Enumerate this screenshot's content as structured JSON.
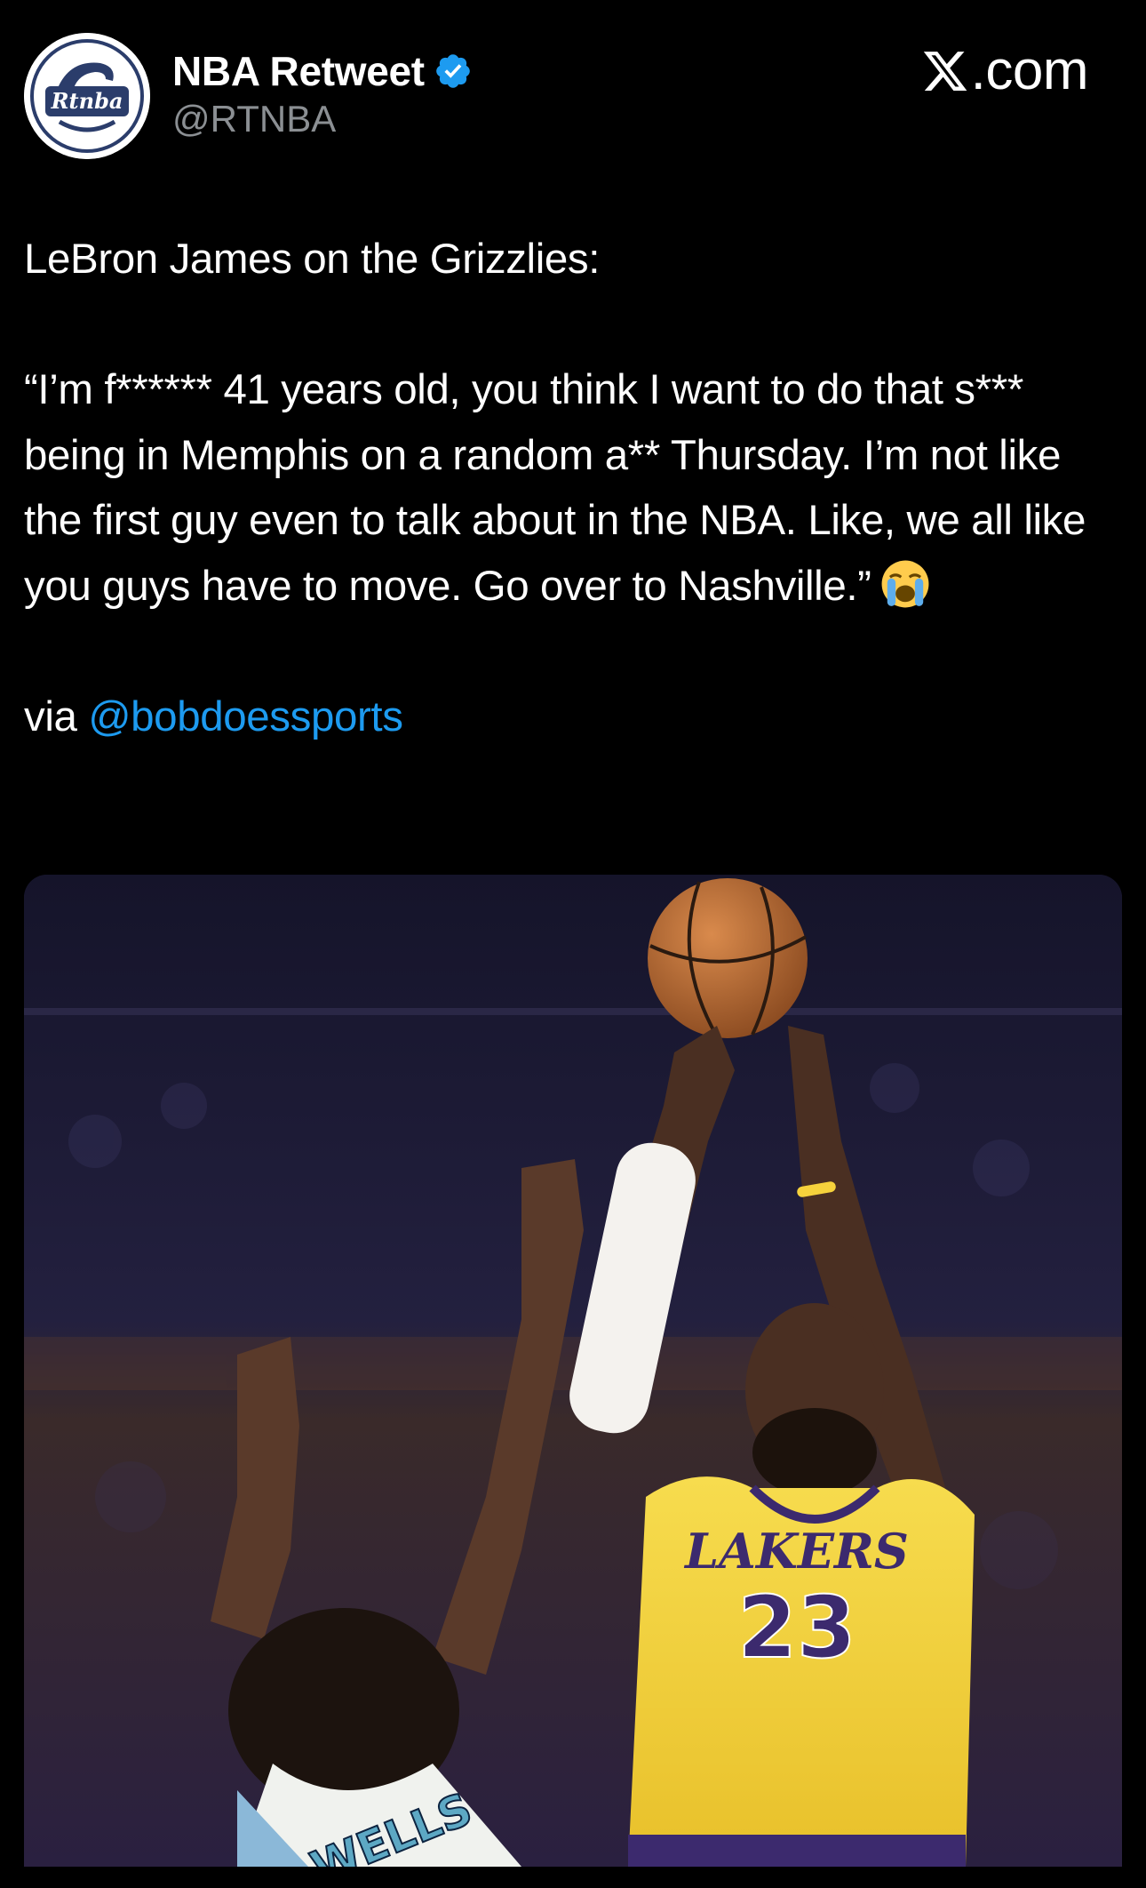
{
  "account": {
    "display_name": "NBA Retweet",
    "handle": "@RTNBA",
    "avatar_text": "Rtnba",
    "verified": true
  },
  "brand": {
    "label": ".com"
  },
  "tweet": {
    "line1": "LeBron James on the Grizzlies:",
    "quote": "“I’m f****** 41 years old, you think I want to do that s*** being in Memphis on a random a** Thursday. I’m not like the first guy even to talk about in the NBA. Like, we all like you guys have to move. Go over to Nashville.”",
    "emoji": "loudly-crying-face",
    "via_label": "via",
    "via_mention": "@bobdoessports"
  },
  "media": {
    "jersey_team": "LAKERS",
    "jersey_number": "23",
    "opponent_name": "WELLS"
  },
  "colors": {
    "background": "#000000",
    "text": "#ffffff",
    "secondary": "#8b8f93",
    "link": "#1d9bf0",
    "verified": "#1d9bf0",
    "lakers_gold": "#f6d23c",
    "lakers_purple": "#3c2a6e"
  }
}
